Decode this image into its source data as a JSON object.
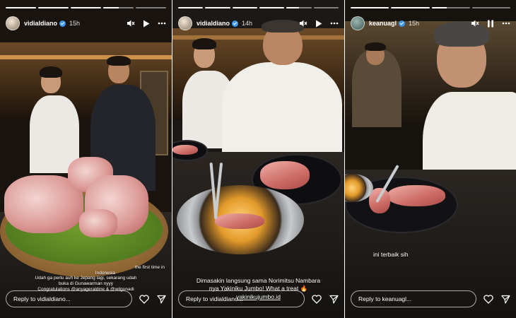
{
  "stories": [
    {
      "username": "vidialdiano",
      "time": "15h",
      "progress": [
        1,
        1,
        1,
        0.5,
        0
      ],
      "caption_lines": [
        "the first time in",
        "Indonesia",
        "Udah ga perlu auh ke Jepang lagi, sekarang udah",
        "buka di Gunawarman nyyy",
        "Congratulations @anyageraldine & @wilgunadi"
      ],
      "reply_placeholder": "Reply to vidialdiano..."
    },
    {
      "username": "vidialdiano",
      "time": "14h",
      "progress": [
        1,
        1,
        1,
        1,
        0.5,
        0
      ],
      "caption_lines": [
        "Dimasakin langsung sama Norimitsu Nambara",
        "nya Yakiniku Jumbo! What a treat 🔥",
        "yakinikujumbo.id"
      ],
      "reply_placeholder": "Reply to vidialdiano..."
    },
    {
      "username": "keanuagl",
      "time": "15h",
      "progress": [
        1,
        1,
        0.4,
        0
      ],
      "caption_lines": [
        "ini terbaik sih"
      ],
      "reply_placeholder": "Reply to keanuagl..."
    }
  ],
  "icons": {
    "mute": "speaker-muted-icon",
    "play": "play-icon",
    "pause": "pause-icon",
    "more": "more-icon",
    "like": "heart-icon",
    "share": "send-icon"
  },
  "colors": {
    "verified": "#3b96f0",
    "amber": "#e0a052"
  }
}
